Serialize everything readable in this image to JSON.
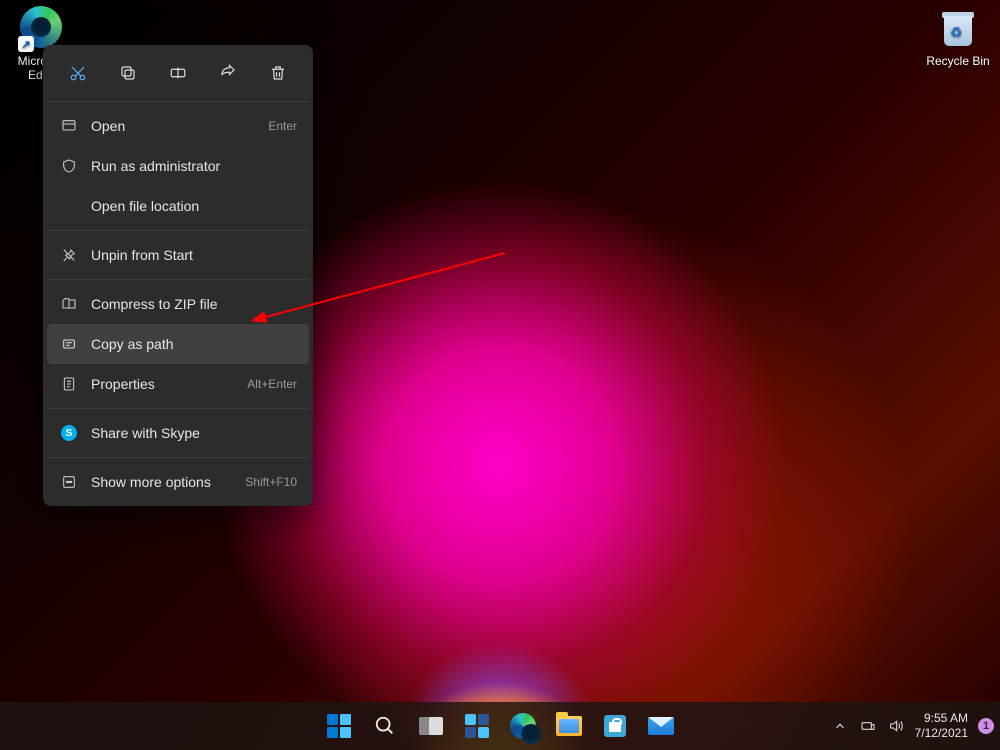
{
  "desktop_icons": {
    "edge_label": "Microsoft Edge",
    "recycle_label": "Recycle Bin"
  },
  "context_menu": {
    "top_actions": [
      "cut",
      "copy",
      "rename",
      "share",
      "delete"
    ],
    "items": [
      {
        "label": "Open",
        "shortcut": "Enter",
        "icon": "open"
      },
      {
        "label": "Run as administrator",
        "shortcut": "",
        "icon": "shield"
      },
      {
        "label": "Open file location",
        "shortcut": "",
        "icon": ""
      },
      {
        "label": "Unpin from Start",
        "shortcut": "",
        "icon": "unpin"
      },
      {
        "label": "Compress to ZIP file",
        "shortcut": "",
        "icon": "zip"
      },
      {
        "label": "Copy as path",
        "shortcut": "",
        "icon": "copypath",
        "hover": true
      },
      {
        "label": "Properties",
        "shortcut": "Alt+Enter",
        "icon": "props"
      },
      {
        "label": "Share with Skype",
        "shortcut": "",
        "icon": "skype"
      },
      {
        "label": "Show more options",
        "shortcut": "Shift+F10",
        "icon": "more"
      }
    ]
  },
  "taskbar": {
    "time": "9:55 AM",
    "date": "7/12/2021",
    "notif_count": "1"
  }
}
